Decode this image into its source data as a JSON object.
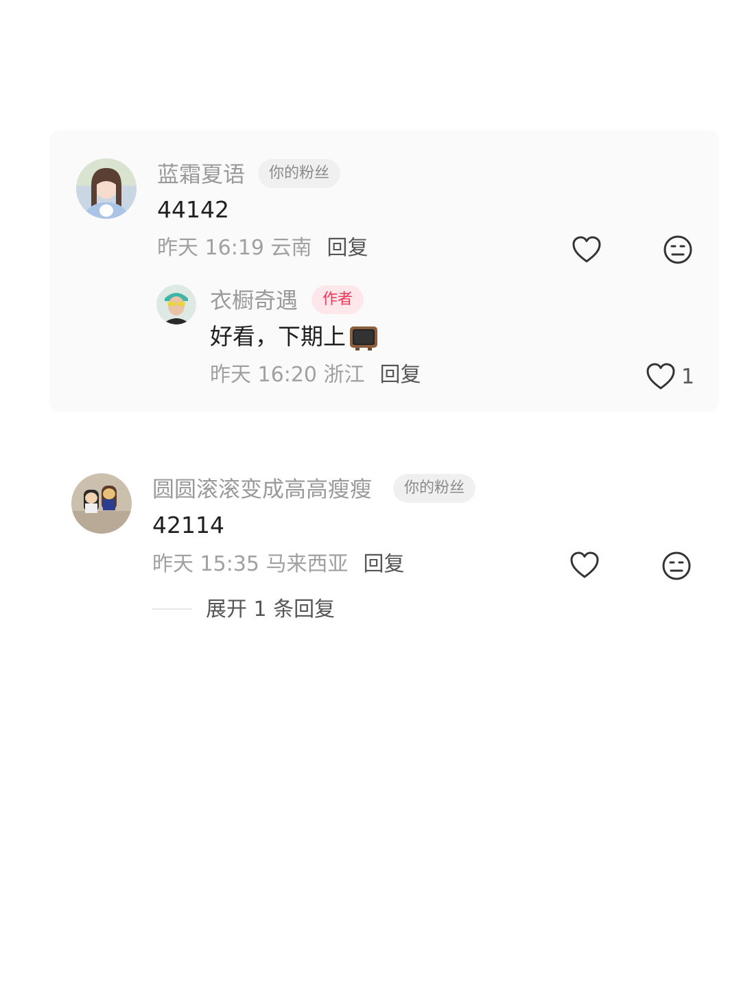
{
  "comments": [
    {
      "user": "蓝霜夏语",
      "badge": "你的粉丝",
      "text": "44142",
      "meta": "昨天 16:19 云南",
      "reply_label": "回复",
      "replies": [
        {
          "user": "衣橱奇遇",
          "badge": "作者",
          "text": "好看，下期上",
          "emoji": "tv-icon",
          "meta": "昨天 16:20 浙江",
          "reply_label": "回复",
          "like_count": "1"
        }
      ]
    },
    {
      "user": "圆圆滚滚变成高高瘦瘦",
      "badge": "你的粉丝",
      "text": "42114",
      "meta": "昨天 15:35 马来西亚",
      "reply_label": "回复",
      "expand_label": "展开 1 条回复"
    }
  ],
  "colors": {
    "author_badge_bg": "#fde7ea",
    "author_badge_text": "#f2365a",
    "fan_badge_bg": "#f0f0f0"
  }
}
